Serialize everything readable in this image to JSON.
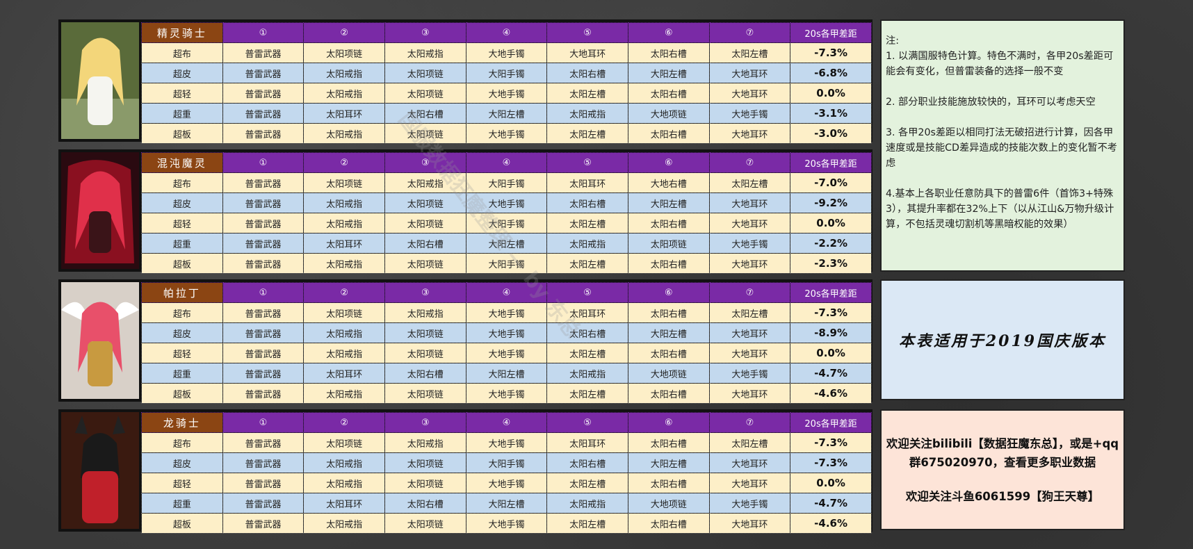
{
  "header_columns": [
    "①",
    "②",
    "③",
    "④",
    "⑤",
    "⑥",
    "⑦",
    "20s各甲差距"
  ],
  "classes": [
    {
      "name": "精灵骑士",
      "rows": [
        {
          "armor": "超布",
          "items": [
            "普雷武器",
            "太阳项链",
            "太阳戒指",
            "大地手镯",
            "大地耳环",
            "太阳右槽",
            "太阳左槽"
          ],
          "diff": "-7.3%"
        },
        {
          "armor": "超皮",
          "items": [
            "普雷武器",
            "太阳戒指",
            "太阳项链",
            "大阳手镯",
            "太阳右槽",
            "大阳左槽",
            "大地耳环"
          ],
          "diff": "-6.8%"
        },
        {
          "armor": "超轻",
          "items": [
            "普雷武器",
            "太阳戒指",
            "太阳项链",
            "大地手镯",
            "太阳左槽",
            "太阳右槽",
            "大地耳环"
          ],
          "diff": "0.0%"
        },
        {
          "armor": "超重",
          "items": [
            "普雷武器",
            "太阳耳环",
            "太阳右槽",
            "大阳左槽",
            "太阳戒指",
            "大地项链",
            "大地手镯"
          ],
          "diff": "-3.1%"
        },
        {
          "armor": "超板",
          "items": [
            "普雷武器",
            "太阳戒指",
            "太阳项链",
            "大地手镯",
            "太阳左槽",
            "太阳右槽",
            "大地耳环"
          ],
          "diff": "-3.0%"
        }
      ]
    },
    {
      "name": "混沌魔灵",
      "rows": [
        {
          "armor": "超布",
          "items": [
            "普雷武器",
            "太阳项链",
            "太阳戒指",
            "大阳手镯",
            "太阳耳环",
            "大地右槽",
            "太阳左槽"
          ],
          "diff": "-7.0%"
        },
        {
          "armor": "超皮",
          "items": [
            "普雷武器",
            "太阳戒指",
            "太阳项链",
            "大地手镯",
            "太阳右槽",
            "大阳左槽",
            "大地耳环"
          ],
          "diff": "-9.2%"
        },
        {
          "armor": "超轻",
          "items": [
            "普雷武器",
            "太阳戒指",
            "太阳项链",
            "大阳手镯",
            "太阳左槽",
            "太阳右槽",
            "大地耳环"
          ],
          "diff": "0.0%"
        },
        {
          "armor": "超重",
          "items": [
            "普雷武器",
            "太阳耳环",
            "太阳右槽",
            "大阳左槽",
            "太阳戒指",
            "太阳项链",
            "大地手镯"
          ],
          "diff": "-2.2%"
        },
        {
          "armor": "超板",
          "items": [
            "普雷武器",
            "太阳戒指",
            "太阳项链",
            "大阳手镯",
            "太阳左槽",
            "太阳右槽",
            "大地耳环"
          ],
          "diff": "-2.3%"
        }
      ]
    },
    {
      "name": "帕拉丁",
      "rows": [
        {
          "armor": "超布",
          "items": [
            "普雷武器",
            "太阳项链",
            "太阳戒指",
            "大地手镯",
            "太阳耳环",
            "太阳右槽",
            "太阳左槽"
          ],
          "diff": "-7.3%"
        },
        {
          "armor": "超皮",
          "items": [
            "普雷武器",
            "太阳戒指",
            "太阳项链",
            "大地手镯",
            "太阳右槽",
            "大阳左槽",
            "大地耳环"
          ],
          "diff": "-8.9%"
        },
        {
          "armor": "超轻",
          "items": [
            "普雷武器",
            "太阳戒指",
            "太阳项链",
            "大地手镯",
            "太阳左槽",
            "太阳右槽",
            "大地耳环"
          ],
          "diff": "0.0%"
        },
        {
          "armor": "超重",
          "items": [
            "普雷武器",
            "太阳耳环",
            "太阳右槽",
            "大阳左槽",
            "太阳戒指",
            "大地项链",
            "大地手镯"
          ],
          "diff": "-4.7%"
        },
        {
          "armor": "超板",
          "items": [
            "普雷武器",
            "太阳戒指",
            "太阳项链",
            "大地手镯",
            "太阳左槽",
            "太阳右槽",
            "大地耳环"
          ],
          "diff": "-4.6%"
        }
      ]
    },
    {
      "name": "龙骑士",
      "rows": [
        {
          "armor": "超布",
          "items": [
            "普雷武器",
            "太阳项链",
            "太阳戒指",
            "大地手镯",
            "太阳耳环",
            "太阳右槽",
            "太阳左槽"
          ],
          "diff": "-7.3%"
        },
        {
          "armor": "超皮",
          "items": [
            "普雷武器",
            "太阳戒指",
            "太阳项链",
            "大阳手镯",
            "太阳右槽",
            "大阳左槽",
            "大地耳环"
          ],
          "diff": "-7.3%"
        },
        {
          "armor": "超轻",
          "items": [
            "普雷武器",
            "太阳戒指",
            "太阳项链",
            "大地手镯",
            "太阳左槽",
            "太阳右槽",
            "大地耳环"
          ],
          "diff": "0.0%"
        },
        {
          "armor": "超重",
          "items": [
            "普雷武器",
            "太阳耳环",
            "太阳右槽",
            "大阳左槽",
            "太阳戒指",
            "大地项链",
            "大地手镯"
          ],
          "diff": "-4.7%"
        },
        {
          "armor": "超板",
          "items": [
            "普雷武器",
            "太阳戒指",
            "太阳项链",
            "大地手镯",
            "太阳左槽",
            "太阳右槽",
            "大地耳环"
          ],
          "diff": "-4.6%"
        }
      ]
    }
  ],
  "notes": {
    "heading": "注:",
    "items": [
      "1. 以满国服特色计算。特色不满时，各甲20s差距可能会有变化，但普雷装备的选择一般不变",
      "2. 部分职业技能施放较快的，耳环可以考虑天空",
      "3. 各甲20s差距以相同打法无破招进行计算，因各甲速度或是技能CD差异造成的技能次数上的变化暂不考虑",
      "4.基本上各职业任意防具下的普雷6件（首饰3+特殊3），其提升率都在32%上下（以从江山&万物升级计算，不包括灵魂切割机等黑暗权能的效果）"
    ]
  },
  "version_note": "本表适用于2019国庆版本",
  "follow": {
    "line1": "欢迎关注bilibili【数据狂魔东总】，或是+qq群675020970，查看更多职业数据",
    "line2": "欢迎关注斗鱼6061599【狗王天尊】"
  },
  "watermark": "国服数据狂魔整理 — by 东总"
}
